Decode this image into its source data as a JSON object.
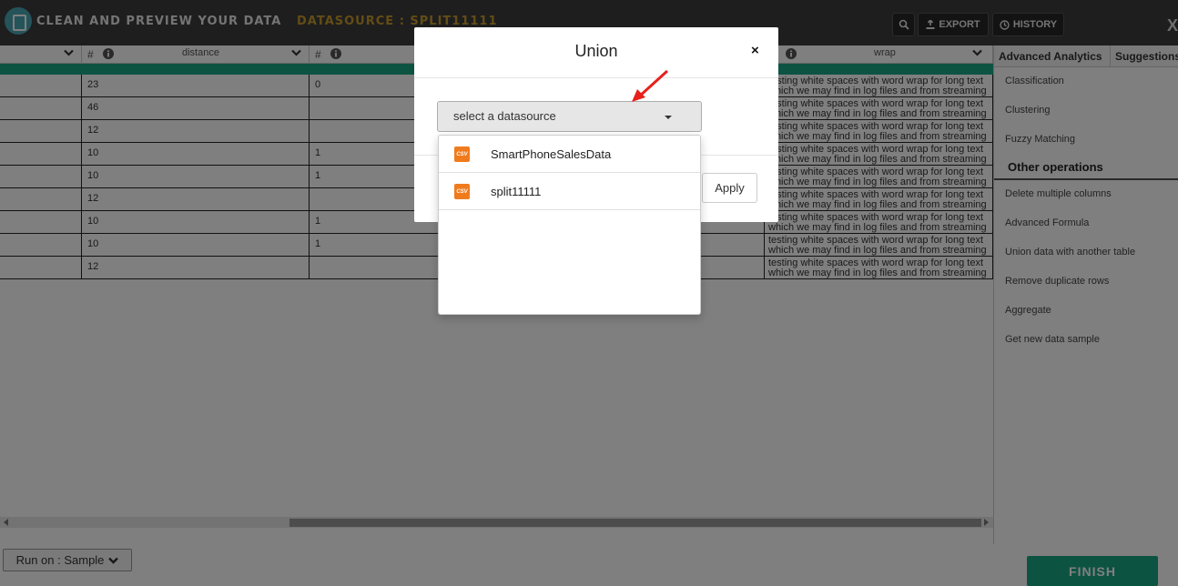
{
  "header": {
    "title": "CLEAN AND PREVIEW YOUR DATA",
    "datasource": "DATASOURCE : SPLIT11111",
    "export_label": "EXPORT",
    "history_label": "HISTORY",
    "close_label": "X"
  },
  "grid": {
    "columns": [
      {
        "type": "",
        "name": ""
      },
      {
        "type": "#",
        "name": "distance"
      },
      {
        "type": "#",
        "name": ""
      },
      {
        "type": "",
        "name": "wrap"
      }
    ],
    "rows": [
      {
        "distance": "23",
        "c3": "0",
        "wrap": "testing white spaces with word wrap for long text which we may find in log files and from streaming"
      },
      {
        "distance": "46",
        "c3": "",
        "wrap": "testing white spaces with word wrap for long text which we may find in log files and from streaming"
      },
      {
        "distance": "12",
        "c3": "",
        "wrap": "testing white spaces with word wrap for long text which we may find in log files and from streaming"
      },
      {
        "distance": "10",
        "c3": "1",
        "wrap": "testing white spaces with word wrap for long text which we may find in log files and from streaming"
      },
      {
        "distance": "10",
        "c3": "1",
        "wrap": "testing white spaces with word wrap for long text which we may find in log files and from streaming"
      },
      {
        "distance": "12",
        "c3": "",
        "wrap": "testing white spaces with word wrap for long text which we may find in log files and from streaming"
      },
      {
        "distance": "10",
        "c3": "1",
        "wrap": "testing white spaces with word wrap for long text which we may find in log files and from streaming"
      },
      {
        "distance": "10",
        "c3": "1",
        "wrap": "testing white spaces with word wrap for long text which we may find in log files and from streaming"
      },
      {
        "distance": "12",
        "c3": "",
        "wrap": "testing white spaces with word wrap for long text which we may find in log files and from streaming"
      }
    ]
  },
  "right_panel": {
    "tabs": [
      "Advanced Analytics",
      "Suggestions"
    ],
    "analytics_items": [
      "Classification",
      "Clustering",
      "Fuzzy Matching"
    ],
    "other_heading": "Other operations",
    "other_items": [
      "Delete multiple columns",
      "Advanced Formula",
      "Union data with another table",
      "Remove duplicate rows",
      "Aggregate",
      "Get new data sample"
    ]
  },
  "footer": {
    "run_label": "Run on : Sample",
    "finish_label": "FINISH"
  },
  "modal": {
    "title": "Union",
    "close": "×",
    "select_placeholder": "select a datasource",
    "apply_label": "Apply",
    "options": [
      {
        "icon": "csv-file-icon",
        "icon_text": "CSV",
        "label": "SmartPhoneSalesData"
      },
      {
        "icon": "csv-file-icon",
        "icon_text": "CSV",
        "label": "split11111"
      }
    ]
  },
  "colors": {
    "accent_teal": "#1ba784",
    "header_bg": "#3d3d3d",
    "datasource_gold": "#c79a2c",
    "csv_orange": "#f07b1d",
    "annotation_arrow": "#e8201c"
  }
}
